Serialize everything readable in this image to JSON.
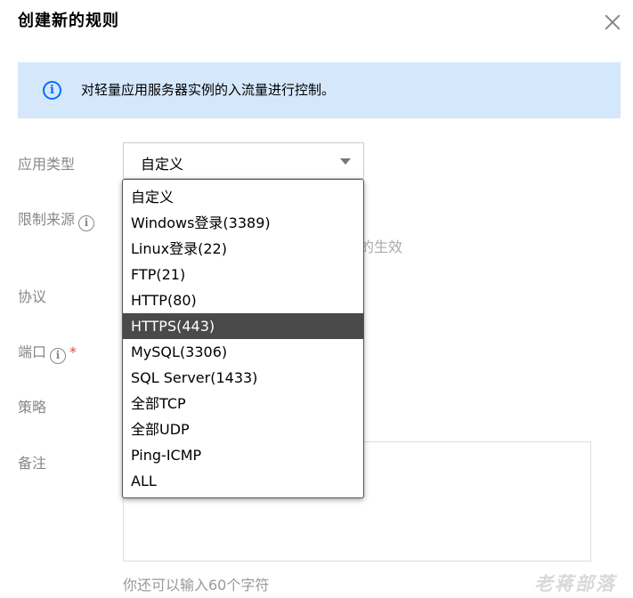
{
  "dialog": {
    "title": "创建新的规则",
    "info_text": "对轻量应用服务器实例的入流量进行控制。"
  },
  "form": {
    "app_type_label": "应用类型",
    "source_label": "限制来源",
    "protocol_label": "协议",
    "port_label": "端口",
    "port_required_mark": "*",
    "policy_label": "策略",
    "remark_label": "备注",
    "help_glyph": "i",
    "selected_value": "自定义",
    "obscured_text": "的生效",
    "char_hint": "你还可以输入60个字符"
  },
  "dropdown": {
    "options": [
      "自定义",
      "Windows登录(3389)",
      "Linux登录(22)",
      "FTP(21)",
      "HTTP(80)",
      "HTTPS(443)",
      "MySQL(3306)",
      "SQL Server(1433)",
      "全部TCP",
      "全部UDP",
      "Ping-ICMP",
      "ALL"
    ],
    "highlighted": "HTTPS(443)"
  },
  "watermark": "老蒋部落",
  "colors": {
    "accent": "#006eff",
    "banner_bg": "#d5e7fb",
    "highlight_bg": "#4a4a4a",
    "required": "#e54545"
  }
}
